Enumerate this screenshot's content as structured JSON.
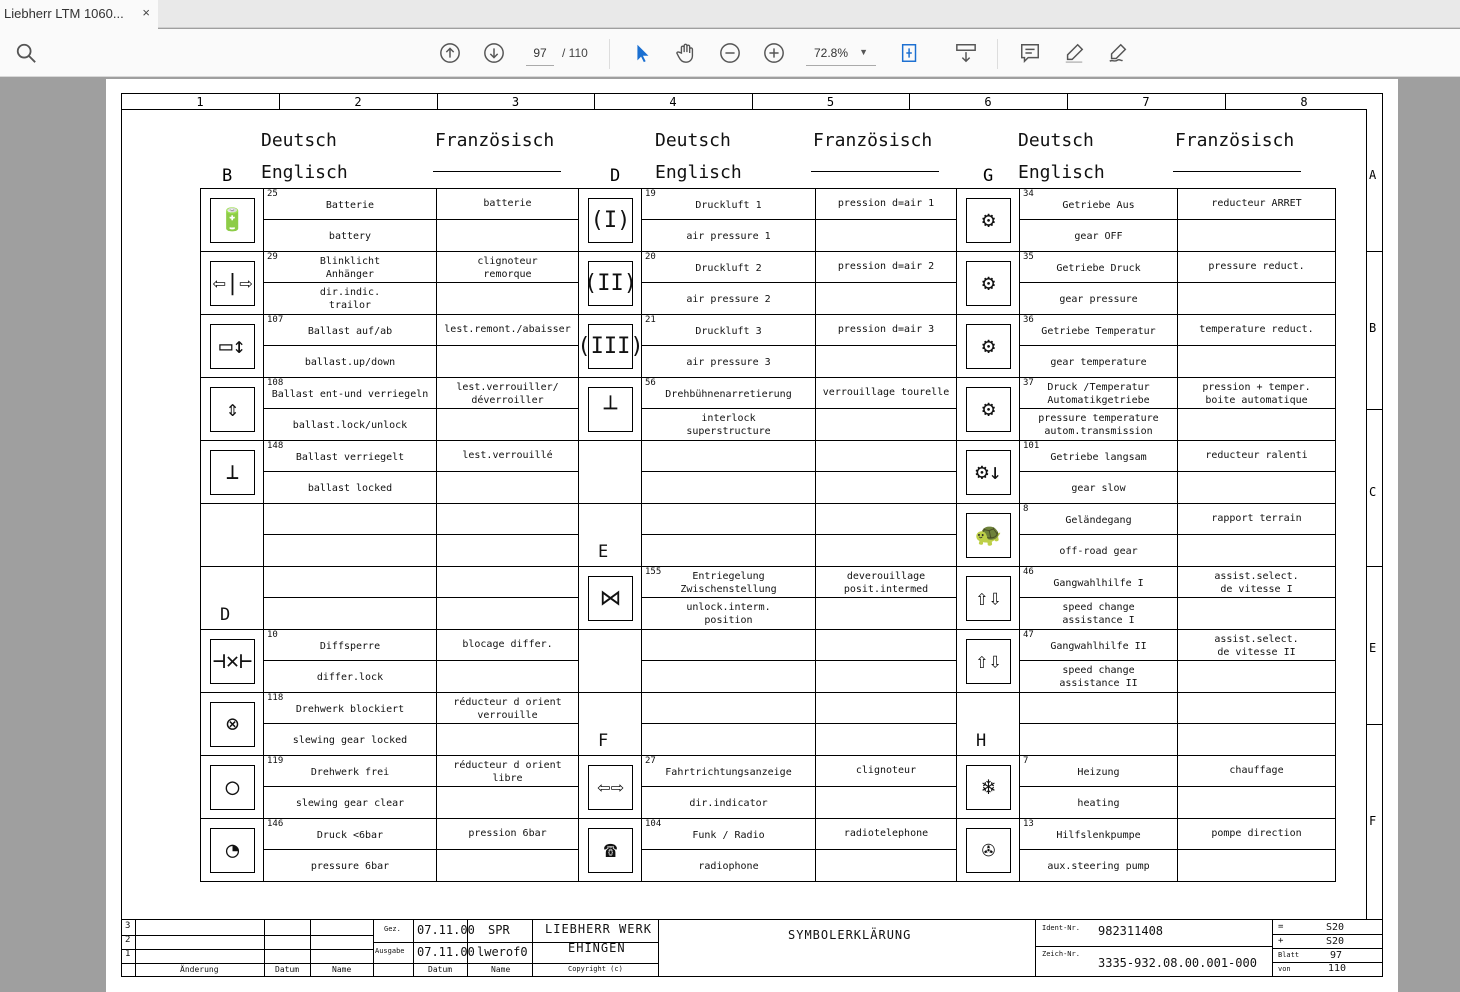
{
  "tab": {
    "title": "Liebherr LTM 1060...",
    "close": "×"
  },
  "toolbar": {
    "page_current": "97",
    "page_total": "/ 110",
    "zoom": "72.8%"
  },
  "drawing": {
    "col_numbers": [
      "1",
      "2",
      "3",
      "4",
      "5",
      "6",
      "7",
      "8"
    ],
    "row_letters": [
      "A",
      "B",
      "C",
      "E",
      "F"
    ],
    "headers": {
      "de": "Deutsch",
      "en": "Englisch",
      "fr": "Französisch"
    },
    "groups": [
      {
        "section": "B",
        "rows": [
          {
            "icon": "battery-icon",
            "glyph": "🔋",
            "num": "25",
            "de": "Batterie",
            "en": "battery",
            "fr": "batterie"
          },
          {
            "icon": "trailer-indicator-icon",
            "glyph": "⇦|⇨",
            "num": "29",
            "de": "Blinklicht\nAnhänger",
            "en": "dir.indic.\ntrailor",
            "fr": "clignoteur\nremorque"
          },
          {
            "icon": "ballast-up-down-icon",
            "glyph": "▭↕",
            "num": "107",
            "de": "Ballast auf/ab",
            "en": "ballast.up/down",
            "fr": "lest.remont./abaisser"
          },
          {
            "icon": "ballast-lock-icon",
            "glyph": "⇕",
            "num": "108",
            "de": "Ballast ent-und verriegeln",
            "en": "ballast.lock/unlock",
            "fr": "lest.verrouiller/\ndéverroiller"
          },
          {
            "icon": "ballast-locked-icon",
            "glyph": "⊥",
            "num": "148",
            "de": "Ballast verriegelt",
            "en": "ballast locked",
            "fr": "lest.verrouillé"
          },
          {
            "empty": true
          },
          {
            "empty": true,
            "label": "D"
          },
          {
            "icon": "diff-lock-icon",
            "glyph": "⊣✕⊢",
            "num": "10",
            "de": "Diffsperre",
            "en": "differ.lock",
            "fr": "blocage differ."
          },
          {
            "icon": "slewing-locked-icon",
            "glyph": "⊗",
            "num": "118",
            "de": "Drehwerk blockiert",
            "en": "slewing gear locked",
            "fr": "réducteur d orient\nverrouille"
          },
          {
            "icon": "slewing-clear-icon",
            "glyph": "◯",
            "num": "119",
            "de": "Drehwerk frei",
            "en": "slewing gear clear",
            "fr": "réducteur d orient\nlibre"
          },
          {
            "icon": "pressure-gauge-icon",
            "glyph": "◔",
            "num": "146",
            "de": "Druck <6bar",
            "en": "pressure  6bar",
            "fr": "pression  6bar"
          }
        ]
      },
      {
        "section": "D",
        "rows": [
          {
            "icon": "air-pressure-1-icon",
            "glyph": "(I)",
            "num": "19",
            "de": "Druckluft 1",
            "en": "air pressure 1",
            "fr": "pression d=air 1"
          },
          {
            "icon": "air-pressure-2-icon",
            "glyph": "(II)",
            "num": "20",
            "de": "Druckluft 2",
            "en": "air pressure 2",
            "fr": "pression d=air 2"
          },
          {
            "icon": "air-pressure-3-icon",
            "glyph": "(III)",
            "num": "21",
            "de": "Druckluft 3",
            "en": "air pressure 3",
            "fr": "pression d=air 3"
          },
          {
            "icon": "superstructure-interlock-icon",
            "glyph": "┴",
            "num": "56",
            "de": "Drehbühnenarretierung",
            "en": "interlock\nsuperstructure",
            "fr": "verrouillage tourelle"
          },
          {
            "empty": true
          },
          {
            "empty": true,
            "label": "E"
          },
          {
            "icon": "unlock-intermediate-icon",
            "glyph": "⋈",
            "num": "155",
            "de": "Entriegelung\nZwischenstellung",
            "en": "unlock.interm.\nposition",
            "fr": "deverouillage\nposit.intermed"
          },
          {
            "empty": true
          },
          {
            "empty": true,
            "label": "F"
          },
          {
            "icon": "direction-indicator-icon",
            "glyph": "⇦⇨",
            "num": "27",
            "de": "Fahrtrichtungsanzeige",
            "en": "dir.indicator",
            "fr": "clignoteur"
          },
          {
            "icon": "radio-phone-icon",
            "glyph": "☎",
            "num": "104",
            "de": "Funk / Radio",
            "en": "radiophone",
            "fr": "radiotelephone"
          }
        ]
      },
      {
        "section": "G",
        "rows": [
          {
            "icon": "gear-off-icon",
            "glyph": "⚙",
            "num": "34",
            "de": "Getriebe Aus",
            "en": "gear OFF",
            "fr": "reducteur ARRET"
          },
          {
            "icon": "gear-pressure-icon",
            "glyph": "⚙",
            "num": "35",
            "de": "Getriebe Druck",
            "en": "gear pressure",
            "fr": "pressure reduct."
          },
          {
            "icon": "gear-temperature-icon",
            "glyph": "⚙",
            "num": "36",
            "de": "Getriebe Temperatur",
            "en": "gear temperature",
            "fr": "temperature reduct."
          },
          {
            "icon": "gear-pressure-temperature-icon",
            "glyph": "⚙",
            "num": "37",
            "de": "Druck /Temperatur\nAutomatikgetriebe",
            "en": "pressure temperature\nautom.transmission",
            "fr": "pression + temper.\nboite automatique"
          },
          {
            "icon": "gear-slow-icon",
            "glyph": "⚙↓",
            "num": "101",
            "de": "Getriebe langsam",
            "en": "gear slow",
            "fr": "reducteur ralenti"
          },
          {
            "icon": "turtle-icon",
            "glyph": "🐢",
            "num": "8",
            "de": "Geländegang",
            "en": "off-road gear",
            "fr": "rapport terrain"
          },
          {
            "icon": "speed-change-1-icon",
            "glyph": "⇧⇩",
            "num": "46",
            "de": "Gangwahlhilfe I",
            "en": "speed change\nassistance I",
            "fr": "assist.select.\nde vitesse I"
          },
          {
            "icon": "speed-change-2-icon",
            "glyph": "⇧⇩",
            "num": "47",
            "de": "Gangwahlhilfe II",
            "en": "speed change\nassistance II",
            "fr": "assist.select.\nde vitesse II"
          },
          {
            "empty": true,
            "label": "H"
          },
          {
            "icon": "heating-icon",
            "glyph": "❄",
            "num": "7",
            "de": "Heizung",
            "en": "heating",
            "fr": "chauffage"
          },
          {
            "icon": "steering-pump-icon",
            "glyph": "✇",
            "num": "13",
            "de": "Hilfslenkpumpe",
            "en": "aux.steering pump",
            "fr": "pompe direction"
          }
        ]
      }
    ]
  },
  "title_block": {
    "rev_numbers": [
      "3",
      "2",
      "1"
    ],
    "labels": {
      "aenderung": "Änderung",
      "datum": "Datum",
      "name": "Name",
      "gez": "Gez.",
      "ausgabe": "Ausgabe",
      "datum2": "Datum",
      "name2": "Name",
      "copyright": "Copyright (c)",
      "ident": "Ident-Nr.",
      "zeich": "Zeich-Nr.",
      "blatt": "Blatt",
      "von": "von",
      "eq": "=",
      "plus": "+"
    },
    "gez_date": "07.11.00",
    "gez_name": "SPR",
    "ausgabe_date": "07.11.00",
    "ausgabe_name": "lwerof0",
    "company_line1": "LIEBHERR WERK",
    "company_line2": "EHINGEN",
    "title": "SYMBOLERKLÄRUNG",
    "ident_nr": "982311408",
    "zeich_nr": "3335-932.08.00.001-000",
    "eq_val": "S20",
    "plus_val": "S20",
    "blatt_val": "97",
    "von_val": "110"
  }
}
